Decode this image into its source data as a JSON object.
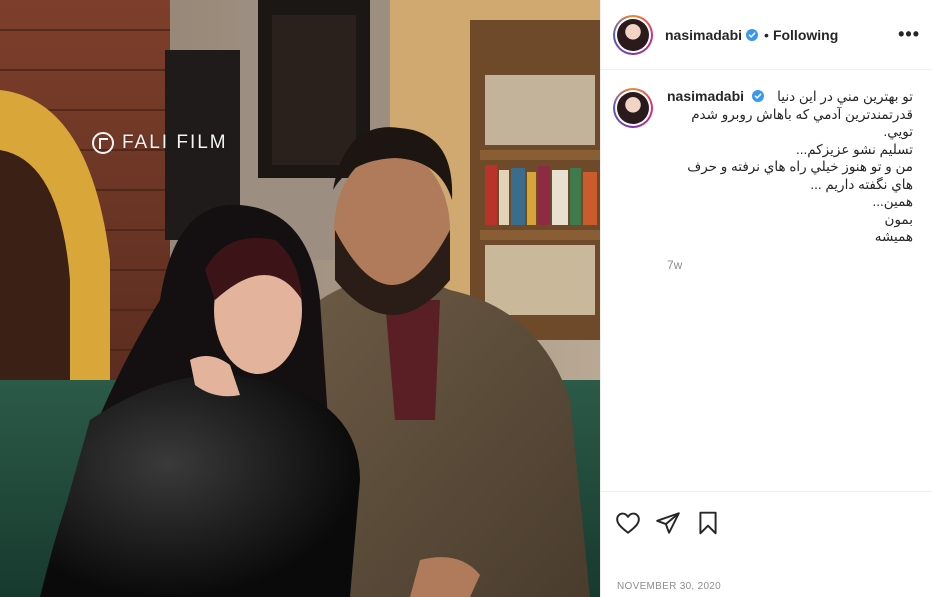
{
  "post": {
    "username": "nasimadabi",
    "follow_status": "Following",
    "separator": "•",
    "more_label": "•••",
    "watermark": "FALI FILM",
    "caption_lines": [
      "تو بهترين مني در اين دنيا",
      "قدرتمندترين آدمي که باهاش روبرو شدم",
      "تويي.",
      "تسليم نشو عزيزكم...",
      "من و تو هنوز خيلي راه هاي نرفته و حرف",
      "هاي نگفته داريم ...",
      "همين...",
      "بمون",
      "هميشه"
    ],
    "relative_time": "7w",
    "date": "NOVEMBER 30, 2020"
  },
  "icons": {
    "verified": "verified-badge-icon",
    "like": "heart-icon",
    "share": "paper-plane-icon",
    "save": "bookmark-icon",
    "more": "more-options-icon"
  },
  "colors": {
    "verified_blue": "#3897f0",
    "text": "#262626",
    "muted": "#8e8e8e",
    "border": "#efefef"
  }
}
